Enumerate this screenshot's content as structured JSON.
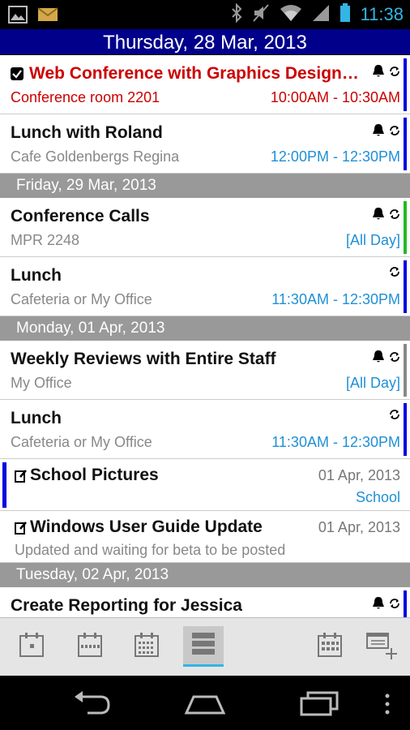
{
  "status": {
    "time": "11:38"
  },
  "header": {
    "date": "Thursday, 28 Mar, 2013"
  },
  "events_thu": [
    {
      "title": "Web Conference with Graphics Design…",
      "location": "Conference room 2201",
      "time": "10:00AM - 10:30AM",
      "bar_color": "#0000e0"
    },
    {
      "title": "Lunch with Roland",
      "location": "Cafe Goldenbergs Regina",
      "time": "12:00PM - 12:30PM",
      "bar_color": "#0000e0"
    }
  ],
  "sections": {
    "fri": "Friday, 29 Mar, 2013",
    "mon": "Monday, 01 Apr, 2013",
    "tue": "Tuesday, 02 Apr, 2013"
  },
  "events_fri": [
    {
      "title": "Conference Calls",
      "location": "MPR 2248",
      "time": "[All Day]",
      "bar_color": "#22bb22"
    },
    {
      "title": "Lunch",
      "location": "Cafeteria or My Office",
      "time": "11:30AM - 12:30PM",
      "bar_color": "#0000e0"
    }
  ],
  "events_mon": [
    {
      "title": "Weekly Reviews with Entire Staff",
      "location": "My Office",
      "time": "[All Day]",
      "bar_color": "#888888"
    },
    {
      "title": "Lunch",
      "location": "Cafeteria or My Office",
      "time": "11:30AM - 12:30PM",
      "bar_color": "#0000e0"
    }
  ],
  "tasks": [
    {
      "title": "School Pictures",
      "date": "01 Apr, 2013",
      "category": "School"
    },
    {
      "title": "Windows User Guide Update",
      "date": "01 Apr, 2013",
      "note": "Updated and waiting for beta to be posted"
    }
  ],
  "events_tue": [
    {
      "title": "Create Reporting for Jessica",
      "bar_color": "#0000e0"
    }
  ],
  "colors": {
    "header_bg": "#00008b",
    "section_bg": "#999999",
    "accent": "#33b5e5",
    "time_blue": "#1e90d6",
    "red": "#cc0000"
  },
  "toolbar_icons": [
    "day-view-icon",
    "week-view-icon",
    "month-view-icon",
    "agenda-view-icon",
    "today-calendar-icon",
    "new-event-icon"
  ]
}
